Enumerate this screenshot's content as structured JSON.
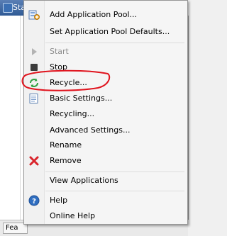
{
  "window": {
    "title": "Sta"
  },
  "bottom_tab": {
    "label": "Fea"
  },
  "menu": {
    "items": [
      {
        "label": "Add Application Pool...",
        "icon": "app-pool-add-icon",
        "enabled": true
      },
      {
        "label": "Set Application Pool Defaults...",
        "icon": "",
        "enabled": true
      },
      {
        "label": "Start",
        "icon": "play-icon",
        "enabled": false
      },
      {
        "label": "Stop",
        "icon": "stop-icon",
        "enabled": true
      },
      {
        "label": "Recycle...",
        "icon": "recycle-icon",
        "enabled": true
      },
      {
        "label": "Basic Settings...",
        "icon": "settings-page-icon",
        "enabled": true
      },
      {
        "label": "Recycling...",
        "icon": "",
        "enabled": true
      },
      {
        "label": "Advanced Settings...",
        "icon": "",
        "enabled": true
      },
      {
        "label": "Rename",
        "icon": "",
        "enabled": true
      },
      {
        "label": "Remove",
        "icon": "remove-x-icon",
        "enabled": true
      },
      {
        "label": "View Applications",
        "icon": "",
        "enabled": true
      },
      {
        "label": "Help",
        "icon": "help-icon",
        "enabled": true
      },
      {
        "label": "Online Help",
        "icon": "",
        "enabled": true
      }
    ]
  },
  "colors": {
    "annotation": "#e0141e",
    "remove": "#d9242b",
    "help": "#2f6ec0",
    "recycle": "#2ea043"
  }
}
